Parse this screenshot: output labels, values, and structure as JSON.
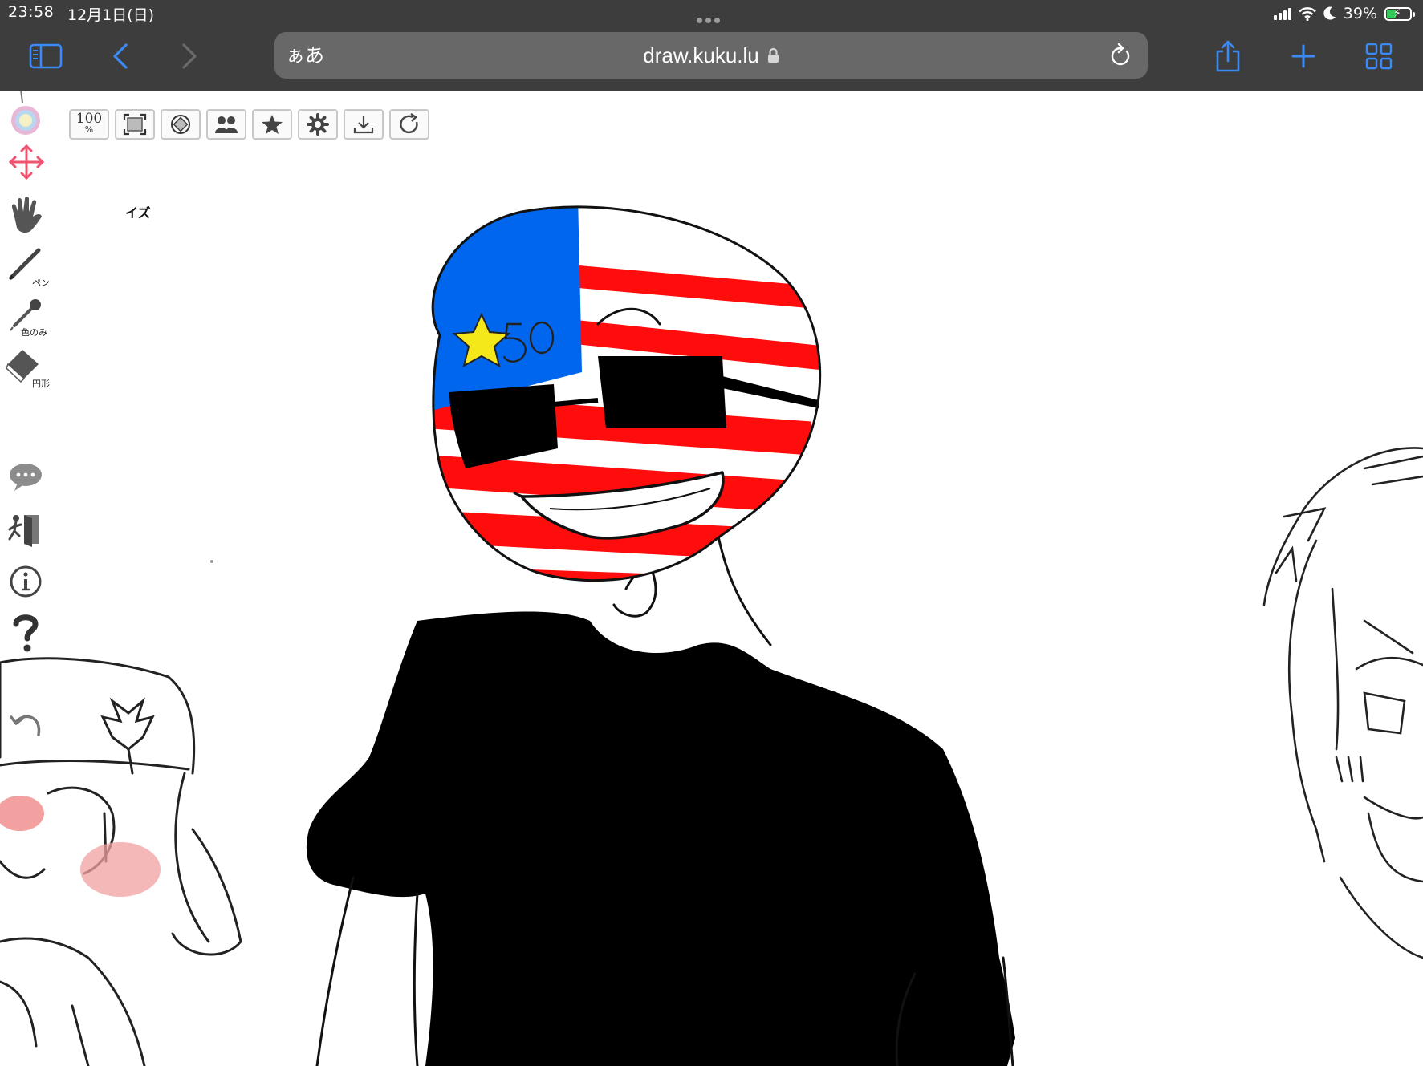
{
  "status": {
    "time": "23:58",
    "date": "12月1日(日)",
    "battery": "39%",
    "battery_level": 0.39
  },
  "browser": {
    "reader_button": "ぁあ",
    "url": "draw.kuku.lu",
    "icons": {
      "sidebar": "sidebar-icon",
      "back": "chevron-left-icon",
      "forward": "chevron-right-icon",
      "lock": "lock-icon",
      "reload": "reload-icon",
      "share": "share-icon",
      "new_tab": "plus-icon",
      "tabs": "tab-grid-icon"
    },
    "accent_color": "#3a8bf5"
  },
  "app": {
    "toolbar": {
      "zoom_value": "100",
      "zoom_unit": "%"
    },
    "side_tools": {
      "pen_label": "ペン",
      "color_label": "色のみ",
      "eraser_label": "円形"
    },
    "hint_text": "イズ"
  }
}
